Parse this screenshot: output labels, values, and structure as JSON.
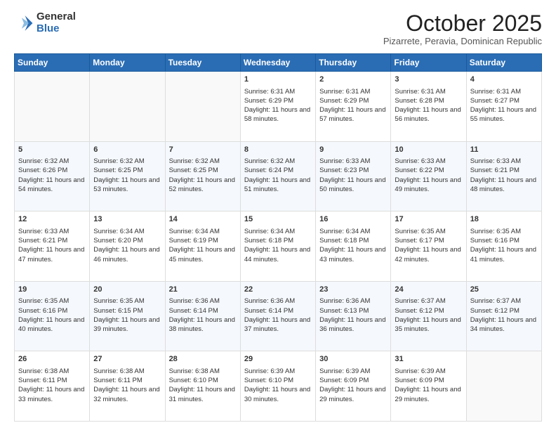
{
  "header": {
    "logo_general": "General",
    "logo_blue": "Blue",
    "month_title": "October 2025",
    "subtitle": "Pizarrete, Peravia, Dominican Republic"
  },
  "weekdays": [
    "Sunday",
    "Monday",
    "Tuesday",
    "Wednesday",
    "Thursday",
    "Friday",
    "Saturday"
  ],
  "weeks": [
    [
      {
        "day": "",
        "content": ""
      },
      {
        "day": "",
        "content": ""
      },
      {
        "day": "",
        "content": ""
      },
      {
        "day": "1",
        "content": "Sunrise: 6:31 AM\nSunset: 6:29 PM\nDaylight: 11 hours and 58 minutes."
      },
      {
        "day": "2",
        "content": "Sunrise: 6:31 AM\nSunset: 6:29 PM\nDaylight: 11 hours and 57 minutes."
      },
      {
        "day": "3",
        "content": "Sunrise: 6:31 AM\nSunset: 6:28 PM\nDaylight: 11 hours and 56 minutes."
      },
      {
        "day": "4",
        "content": "Sunrise: 6:31 AM\nSunset: 6:27 PM\nDaylight: 11 hours and 55 minutes."
      }
    ],
    [
      {
        "day": "5",
        "content": "Sunrise: 6:32 AM\nSunset: 6:26 PM\nDaylight: 11 hours and 54 minutes."
      },
      {
        "day": "6",
        "content": "Sunrise: 6:32 AM\nSunset: 6:25 PM\nDaylight: 11 hours and 53 minutes."
      },
      {
        "day": "7",
        "content": "Sunrise: 6:32 AM\nSunset: 6:25 PM\nDaylight: 11 hours and 52 minutes."
      },
      {
        "day": "8",
        "content": "Sunrise: 6:32 AM\nSunset: 6:24 PM\nDaylight: 11 hours and 51 minutes."
      },
      {
        "day": "9",
        "content": "Sunrise: 6:33 AM\nSunset: 6:23 PM\nDaylight: 11 hours and 50 minutes."
      },
      {
        "day": "10",
        "content": "Sunrise: 6:33 AM\nSunset: 6:22 PM\nDaylight: 11 hours and 49 minutes."
      },
      {
        "day": "11",
        "content": "Sunrise: 6:33 AM\nSunset: 6:21 PM\nDaylight: 11 hours and 48 minutes."
      }
    ],
    [
      {
        "day": "12",
        "content": "Sunrise: 6:33 AM\nSunset: 6:21 PM\nDaylight: 11 hours and 47 minutes."
      },
      {
        "day": "13",
        "content": "Sunrise: 6:34 AM\nSunset: 6:20 PM\nDaylight: 11 hours and 46 minutes."
      },
      {
        "day": "14",
        "content": "Sunrise: 6:34 AM\nSunset: 6:19 PM\nDaylight: 11 hours and 45 minutes."
      },
      {
        "day": "15",
        "content": "Sunrise: 6:34 AM\nSunset: 6:18 PM\nDaylight: 11 hours and 44 minutes."
      },
      {
        "day": "16",
        "content": "Sunrise: 6:34 AM\nSunset: 6:18 PM\nDaylight: 11 hours and 43 minutes."
      },
      {
        "day": "17",
        "content": "Sunrise: 6:35 AM\nSunset: 6:17 PM\nDaylight: 11 hours and 42 minutes."
      },
      {
        "day": "18",
        "content": "Sunrise: 6:35 AM\nSunset: 6:16 PM\nDaylight: 11 hours and 41 minutes."
      }
    ],
    [
      {
        "day": "19",
        "content": "Sunrise: 6:35 AM\nSunset: 6:16 PM\nDaylight: 11 hours and 40 minutes."
      },
      {
        "day": "20",
        "content": "Sunrise: 6:35 AM\nSunset: 6:15 PM\nDaylight: 11 hours and 39 minutes."
      },
      {
        "day": "21",
        "content": "Sunrise: 6:36 AM\nSunset: 6:14 PM\nDaylight: 11 hours and 38 minutes."
      },
      {
        "day": "22",
        "content": "Sunrise: 6:36 AM\nSunset: 6:14 PM\nDaylight: 11 hours and 37 minutes."
      },
      {
        "day": "23",
        "content": "Sunrise: 6:36 AM\nSunset: 6:13 PM\nDaylight: 11 hours and 36 minutes."
      },
      {
        "day": "24",
        "content": "Sunrise: 6:37 AM\nSunset: 6:12 PM\nDaylight: 11 hours and 35 minutes."
      },
      {
        "day": "25",
        "content": "Sunrise: 6:37 AM\nSunset: 6:12 PM\nDaylight: 11 hours and 34 minutes."
      }
    ],
    [
      {
        "day": "26",
        "content": "Sunrise: 6:38 AM\nSunset: 6:11 PM\nDaylight: 11 hours and 33 minutes."
      },
      {
        "day": "27",
        "content": "Sunrise: 6:38 AM\nSunset: 6:11 PM\nDaylight: 11 hours and 32 minutes."
      },
      {
        "day": "28",
        "content": "Sunrise: 6:38 AM\nSunset: 6:10 PM\nDaylight: 11 hours and 31 minutes."
      },
      {
        "day": "29",
        "content": "Sunrise: 6:39 AM\nSunset: 6:10 PM\nDaylight: 11 hours and 30 minutes."
      },
      {
        "day": "30",
        "content": "Sunrise: 6:39 AM\nSunset: 6:09 PM\nDaylight: 11 hours and 29 minutes."
      },
      {
        "day": "31",
        "content": "Sunrise: 6:39 AM\nSunset: 6:09 PM\nDaylight: 11 hours and 29 minutes."
      },
      {
        "day": "",
        "content": ""
      }
    ]
  ]
}
